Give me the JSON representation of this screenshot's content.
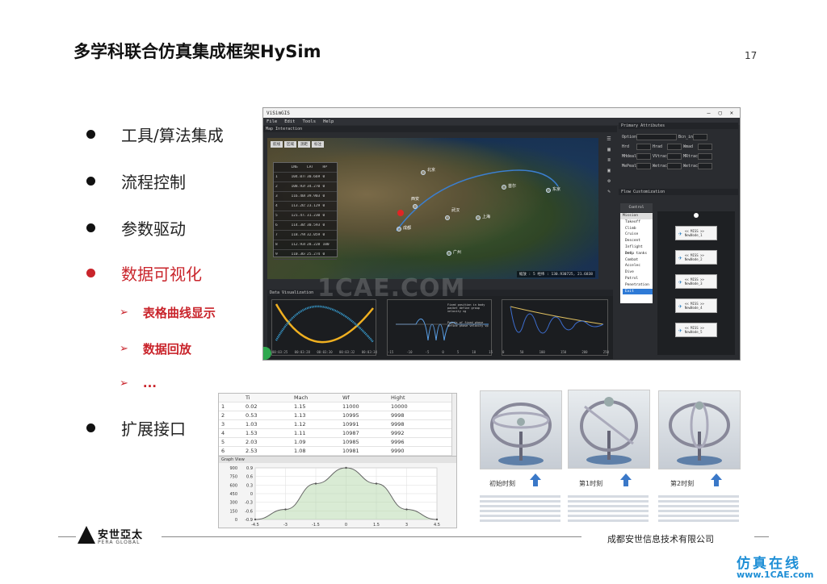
{
  "slide": {
    "title": "多学科联合仿真集成框架HySim",
    "page_number": "17",
    "bullets": [
      {
        "text": "工具/算法集成",
        "highlight": false
      },
      {
        "text": "流程控制",
        "highlight": false
      },
      {
        "text": "参数驱动",
        "highlight": false
      },
      {
        "text": "数据可视化",
        "highlight": true
      },
      {
        "text": "扩展接口",
        "highlight": false
      }
    ],
    "sub_bullets": [
      "表格曲线显示",
      "数据回放",
      "..."
    ],
    "colors": {
      "accent": "#c9242b",
      "watermark": "#1f8fd6"
    }
  },
  "app": {
    "window_title": "ViSimGIS",
    "menu": [
      "File",
      "Edit",
      "Tools",
      "Help"
    ],
    "map_panel_title": "Map Interaction",
    "map_table_headers": [
      "",
      "LNG",
      "LAT",
      "HP"
    ],
    "map_table_rows": [
      [
        "1",
        "104.074",
        "30.669",
        "0"
      ],
      [
        "2",
        "108.939",
        "34.270",
        "0"
      ],
      [
        "3",
        "116.400",
        "39.903",
        "0"
      ],
      [
        "4",
        "113.265",
        "23.129",
        "0"
      ],
      [
        "5",
        "121.473",
        "31.230",
        "0"
      ],
      [
        "6",
        "114.305",
        "30.593",
        "0"
      ],
      [
        "7",
        "118.796",
        "32.059",
        "0"
      ],
      [
        "8",
        "112.938",
        "28.228",
        "100"
      ],
      [
        "9",
        "110.364",
        "25.274",
        "0"
      ]
    ],
    "map_labels": [
      "北京",
      "成都",
      "上海",
      "广州",
      "武汉",
      "西安",
      "东京",
      "首尔"
    ],
    "map_coord_readout": "缩放 : 5    经纬 : 130.930725, 21.6838",
    "data_panel_title": "Data Visualization",
    "primary_attributes_title": "Primary Attributes",
    "attributes": [
      {
        "label": "Option",
        "value": "Blk"
      },
      {
        "label": "Bcn_in",
        "value": "0.00"
      },
      {
        "label": "Hrd",
        "value": "0.00"
      },
      {
        "label": "Hrad",
        "value": "0.00"
      },
      {
        "label": "Wmad",
        "value": "0.00"
      },
      {
        "label": "MHdeal",
        "value": "0.00"
      },
      {
        "label": "VVtrack",
        "value": "0.00"
      },
      {
        "label": "MRtrack",
        "value": "0.00"
      },
      {
        "label": "MePeal",
        "value": "0.00"
      },
      {
        "label": "Wetrack",
        "value": "0.00"
      },
      {
        "label": "Wetrack2",
        "value": "0.00"
      }
    ],
    "flow_title": "Flow Customization",
    "flow_list_headers": [
      "Control",
      "Mission"
    ],
    "flow_list_items": [
      "Takeoff",
      "Climb",
      "Cruise",
      "Descent",
      "Inflight refu",
      "Drop tanks",
      "Combat",
      "Accelec",
      "Dive",
      "Patrol",
      "Penetration",
      "Exit"
    ],
    "flow_selected": "Exit",
    "flow_nodes": [
      "<< MISS >> NewNode_1",
      "<< MISS >> NewNode_2",
      "<< MISS >> NewNode_3",
      "<< MISS >> NewNode_4",
      "<< MISS >> NewNode_5"
    ],
    "chart1_ticks": [
      "00:03:25",
      "00:03:28",
      "00:03:30",
      "00:03:32",
      "00:03:34"
    ],
    "chart2_ticks": [
      "-15",
      "-10",
      "-5",
      "0",
      "5",
      "10",
      "15"
    ],
    "chart2_annotations": [
      "Fixed position in body packet define group velocity vg",
      "Points of fixed phase define phase velocity vp"
    ],
    "chart3_ticks": [
      "0",
      "50",
      "100",
      "150",
      "200",
      "250"
    ]
  },
  "bottom_table": {
    "headers": [
      "",
      "Ti",
      "Mach",
      "Wf",
      "Hight"
    ],
    "rows": [
      [
        "1",
        "0.02",
        "1.15",
        "11000",
        "10000"
      ],
      [
        "2",
        "0.53",
        "1.13",
        "10995",
        "9998"
      ],
      [
        "3",
        "1.03",
        "1.12",
        "10991",
        "9998"
      ],
      [
        "4",
        "1.53",
        "1.11",
        "10987",
        "9992"
      ],
      [
        "5",
        "2.03",
        "1.09",
        "10985",
        "9996"
      ],
      [
        "6",
        "2.53",
        "1.08",
        "10981",
        "9990"
      ]
    ],
    "graph_title": "Graph View"
  },
  "chart_data": [
    {
      "type": "line",
      "title": "",
      "x": [
        -4.5,
        -3,
        -1.5,
        0,
        1.5,
        3,
        4.5
      ],
      "xticks": [
        "-4.5",
        "-3",
        "-1.5",
        "0",
        "1.5",
        "3",
        "4.5"
      ],
      "yticks_left": [
        "0.9",
        "0.6",
        "0.3",
        "0",
        "-0.3",
        "-0.6",
        "-0.9"
      ],
      "yticks_right": [
        "900",
        "750",
        "600",
        "450",
        "300",
        "150",
        "0"
      ],
      "series": [
        {
          "values": [
            -0.9,
            -0.55,
            0.35,
            0.9,
            0.35,
            -0.55,
            -0.9
          ]
        }
      ],
      "ylim": [
        -0.9,
        0.9
      ],
      "grid": true
    }
  ],
  "gyro_captions": [
    "初始时刻",
    "第1时刻",
    "第2时刻"
  ],
  "footer": {
    "logo_name": "安世亞太",
    "logo_en": "PERA GLOBAL",
    "company": "成都安世信息技术有限公司"
  },
  "watermarks": {
    "app": "1CAE.COM",
    "corner_cn": "仿真在线",
    "corner_url": "www.1CAE.com"
  }
}
